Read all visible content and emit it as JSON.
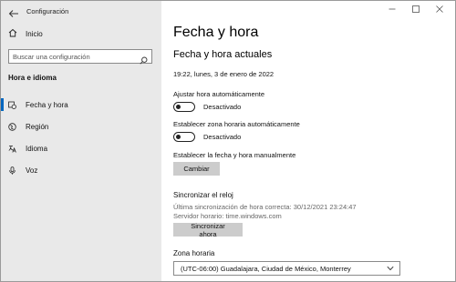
{
  "window": {
    "app_title": "Configuración"
  },
  "sidebar": {
    "home_label": "Inicio",
    "search_placeholder": "Buscar una configuración",
    "section_title": "Hora e idioma",
    "items": [
      {
        "label": "Fecha y hora",
        "icon": "calendar-clock-icon",
        "active": true
      },
      {
        "label": "Región",
        "icon": "globe-icon",
        "active": false
      },
      {
        "label": "Idioma",
        "icon": "language-icon",
        "active": false
      },
      {
        "label": "Voz",
        "icon": "microphone-icon",
        "active": false
      }
    ]
  },
  "main": {
    "page_title": "Fecha y hora",
    "sub_title": "Fecha y hora actuales",
    "current_datetime": "19:22, lunes, 3 de enero de 2022",
    "auto_time": {
      "label": "Ajustar hora automáticamente",
      "state_text": "Desactivado"
    },
    "auto_timezone": {
      "label": "Establecer zona horaria automáticamente",
      "state_text": "Desactivado"
    },
    "manual": {
      "label": "Establecer la fecha y hora manualmente",
      "button": "Cambiar"
    },
    "sync": {
      "heading": "Sincronizar el reloj",
      "last_sync": "Última sincronización de hora correcta: 30/12/2021 23:24:47",
      "server": "Servidor horario: time.windows.com",
      "button": "Sincronizar ahora"
    },
    "timezone": {
      "label": "Zona horaria",
      "selected": "(UTC-06:00) Guadalajara, Ciudad de México, Monterrey"
    }
  },
  "colors": {
    "sidebar_bg": "#e9e9e9",
    "accent": "#0067c0",
    "button_bg": "#cccccc"
  }
}
